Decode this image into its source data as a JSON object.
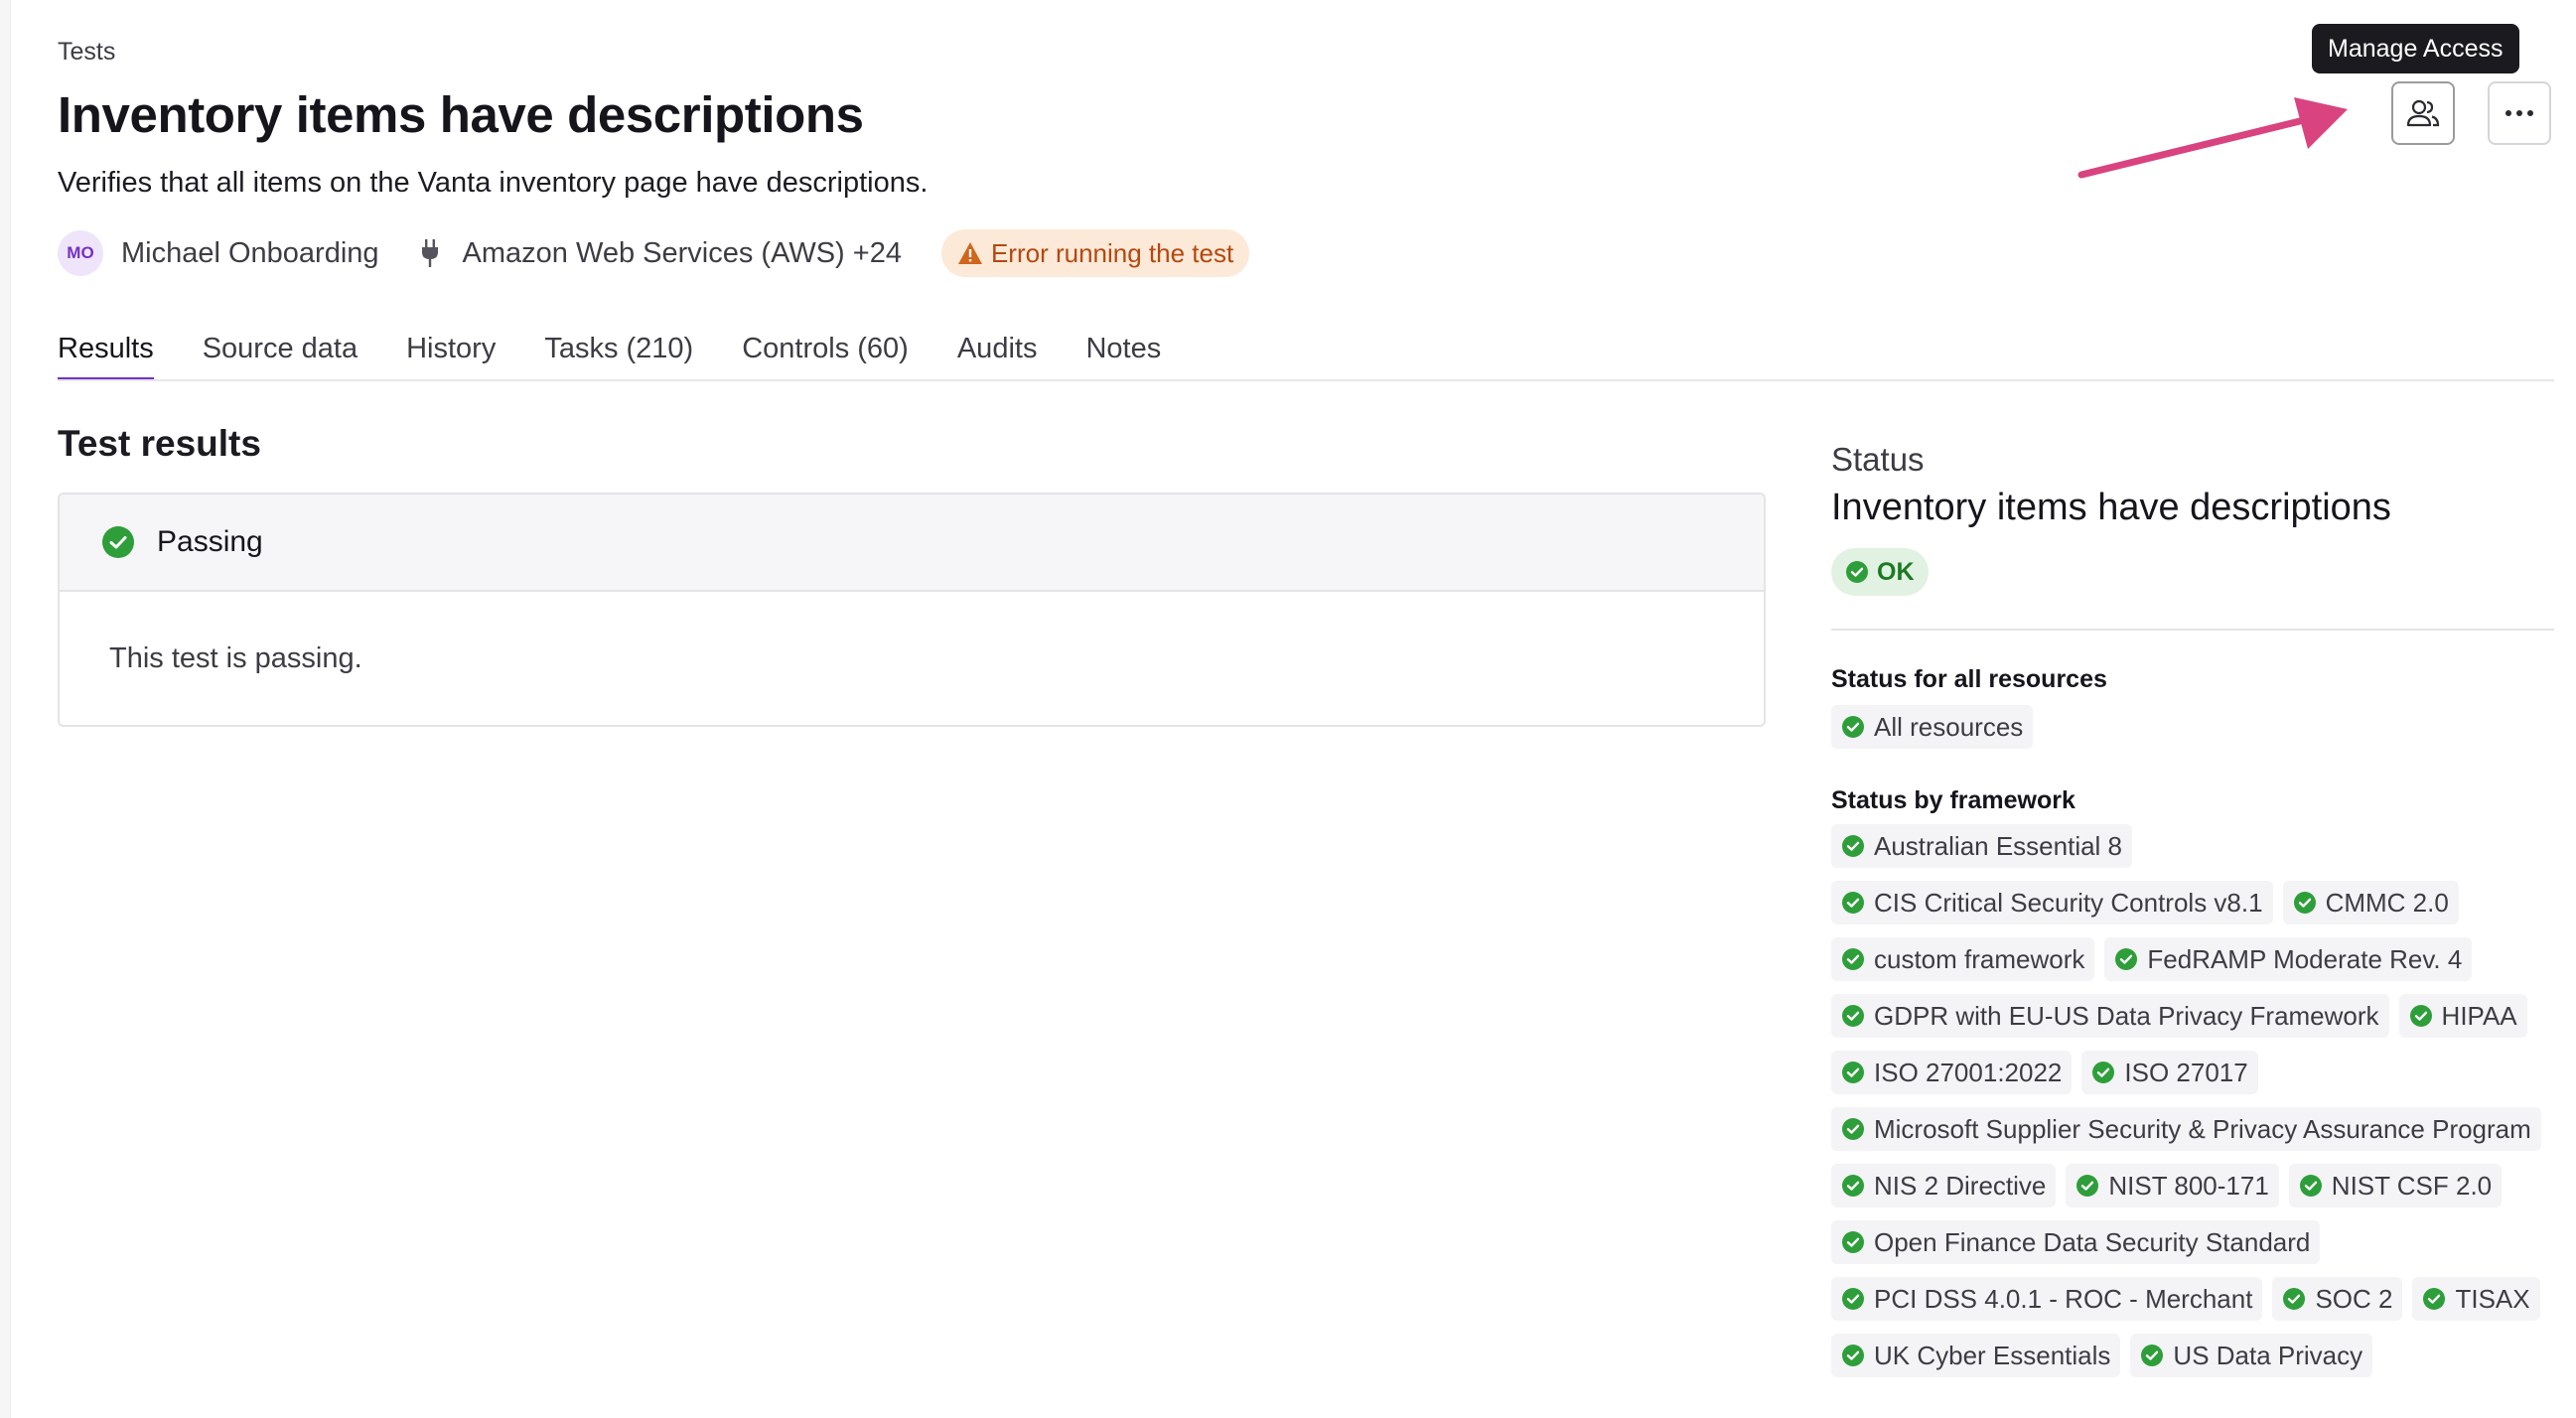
{
  "breadcrumb": "Tests",
  "header": {
    "title": "Inventory items have descriptions",
    "description": "Verifies that all items on the Vanta inventory page have descriptions.",
    "owner_initials": "MO",
    "owner_name": "Michael Onboarding",
    "integration": "Amazon Web Services (AWS) +24",
    "error_badge": "Error running the test"
  },
  "tooltip": "Manage Access",
  "tabs": [
    "Results",
    "Source data",
    "History",
    "Tasks (210)",
    "Controls (60)",
    "Audits",
    "Notes"
  ],
  "active_tab": "Results",
  "results": {
    "section_title": "Test results",
    "status_label": "Passing",
    "message": "This test is passing."
  },
  "status_panel": {
    "label": "Status",
    "title": "Inventory items have descriptions",
    "status": "OK",
    "all_resources_heading": "Status for all resources",
    "all_resources_chip": "All resources",
    "framework_heading": "Status by framework",
    "framework_rows": [
      [
        "Australian Essential 8"
      ],
      [
        "CIS Critical Security Controls v8.1",
        "CMMC 2.0"
      ],
      [
        "custom framework",
        "FedRAMP Moderate Rev. 4"
      ],
      [
        "GDPR with EU-US Data Privacy Framework",
        "HIPAA"
      ],
      [
        "ISO 27001:2022",
        "ISO 27017"
      ],
      [
        "Microsoft Supplier Security & Privacy Assurance Program"
      ],
      [
        "NIS 2 Directive",
        "NIST 800-171",
        "NIST CSF 2.0"
      ],
      [
        "Open Finance Data Security Standard"
      ],
      [
        "PCI DSS 4.0.1 - ROC - Merchant",
        "SOC 2",
        "TISAX"
      ],
      [
        "UK Cyber Essentials",
        "US Data Privacy"
      ]
    ]
  },
  "colors": {
    "accent": "#7431c4",
    "success": "#2e9e3a",
    "warning": "#d0661b",
    "annotation_arrow": "#d9437f"
  },
  "icons": {
    "manage_access": "users-icon",
    "more": "ellipsis-icon",
    "integration": "plug-icon",
    "error": "warning-icon",
    "status": "check-circle-icon"
  }
}
